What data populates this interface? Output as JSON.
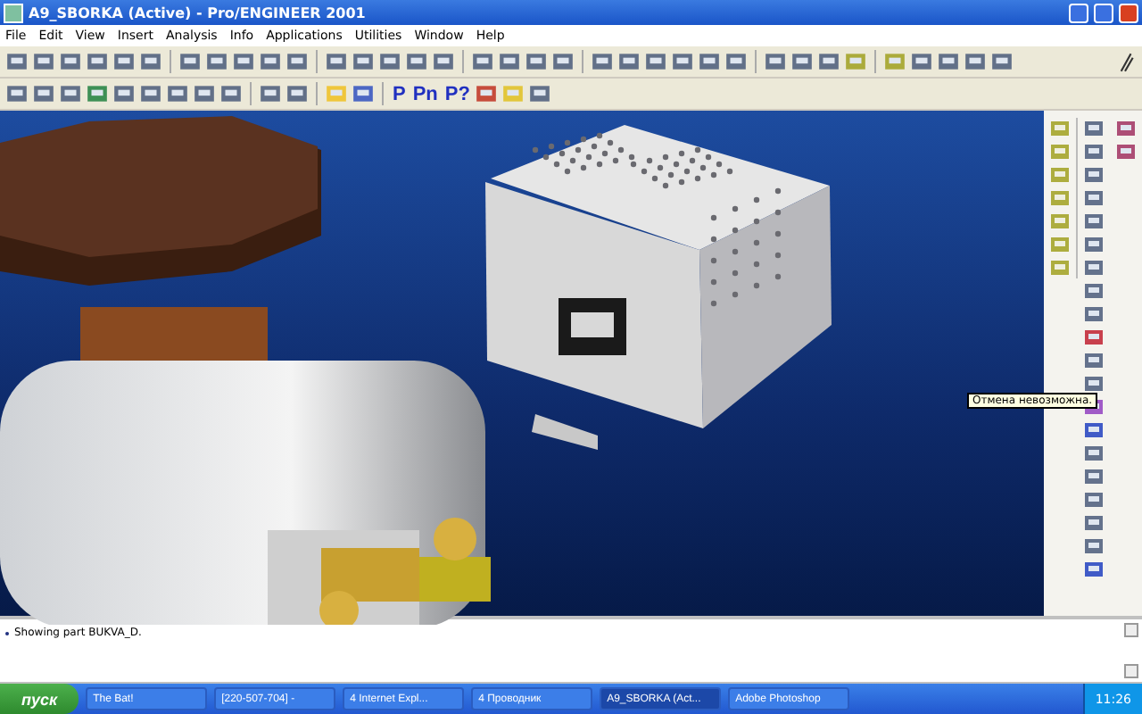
{
  "window": {
    "title": "A9_SBORKA (Active) - Pro/ENGINEER 2001"
  },
  "menu": [
    "File",
    "Edit",
    "View",
    "Insert",
    "Analysis",
    "Info",
    "Applications",
    "Utilities",
    "Window",
    "Help"
  ],
  "toolbar_letters": [
    "P",
    "Pn",
    "P?"
  ],
  "tooltip": "Отмена невозможна.",
  "message_area": {
    "lines": [
      "Showing part BUKVA_D."
    ]
  },
  "taskbar": {
    "start": "пуск",
    "tasks": [
      {
        "label": "The Bat!",
        "selected": false
      },
      {
        "label": "[220-507-704] -",
        "selected": false
      },
      {
        "label": "4 Internet Expl...",
        "selected": false
      },
      {
        "label": "4 Проводник",
        "selected": false
      },
      {
        "label": "A9_SBORKA (Act...",
        "selected": true
      },
      {
        "label": "Adobe Photoshop",
        "selected": false
      }
    ],
    "clock": "11:26"
  }
}
